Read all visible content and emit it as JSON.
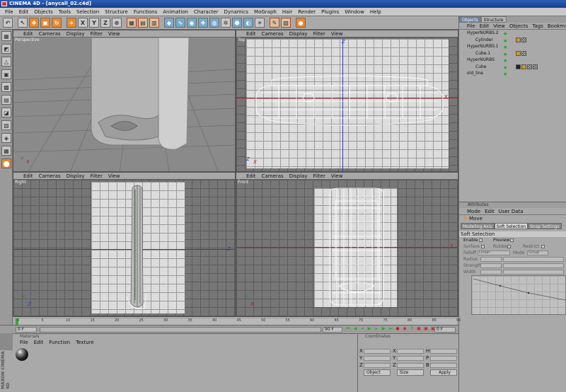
{
  "window": {
    "title": "CINEMA 4D - [anycall_02.c4d]"
  },
  "menubar": [
    "File",
    "Edit",
    "Objects",
    "Tools",
    "Selection",
    "Structure",
    "Functions",
    "Animation",
    "Character",
    "Dynamics",
    "MoGraph",
    "Hair",
    "Render",
    "Plugins",
    "Window",
    "Help"
  ],
  "toolbar": {
    "axis_x": "X",
    "axis_y": "Y",
    "axis_z": "Z"
  },
  "viewport_menu": [
    "Edit",
    "Cameras",
    "Display",
    "Filter",
    "View"
  ],
  "viewports": {
    "perspective": "Perspective",
    "top": "Top",
    "right": "Right",
    "front": "Front"
  },
  "axes": {
    "x": "X",
    "y": "Y",
    "z": "Z"
  },
  "objects_panel": {
    "tabs": [
      "Objects",
      "Structure"
    ],
    "menu": [
      "File",
      "Edit",
      "View",
      "Objects",
      "Tags",
      "Bookmarks"
    ],
    "items": [
      {
        "name": "HyperNURBS.2",
        "indent": 0
      },
      {
        "name": "Cylinder",
        "indent": 1
      },
      {
        "name": "HyperNURBS.1",
        "indent": 0
      },
      {
        "name": "Cube.1",
        "indent": 1
      },
      {
        "name": "HyperNURBS",
        "indent": 0
      },
      {
        "name": "Cube",
        "indent": 1
      },
      {
        "name": "old_line",
        "indent": 0
      }
    ]
  },
  "attributes": {
    "header": "Attributes",
    "menu": [
      "Mode",
      "Edit",
      "User Data"
    ],
    "tool": "Move",
    "tabs": [
      "Modeling Axis",
      "Soft Selection",
      "Snap Settings"
    ],
    "section": "Soft Selection",
    "enable": "Enable",
    "preview": "Preview",
    "surface": "Surface",
    "rubber": "Rubber",
    "restrict": "Restrict",
    "falloff_label": "Falloff",
    "falloff_value": "Linear",
    "mode_label": "Mode",
    "mode_value": "Group",
    "radius_label": "Radius",
    "strength_label": "Strength",
    "width_label": "Width"
  },
  "timeline": {
    "ticks": [
      "0",
      "5",
      "10",
      "15",
      "20",
      "25",
      "30",
      "35",
      "40",
      "45",
      "50",
      "55",
      "60",
      "65",
      "70",
      "75",
      "80",
      "85",
      "90"
    ],
    "current_frame": "0 F",
    "start": "0 F",
    "end": "90 F",
    "right_field": "0 F"
  },
  "materials": {
    "header": "Materials",
    "menu": [
      "File",
      "Edit",
      "Function",
      "Texture"
    ]
  },
  "coordinates": {
    "header": "Coordinates",
    "labels": [
      "X",
      "Y",
      "Z",
      "X",
      "Y",
      "Z",
      "H",
      "P",
      "B"
    ],
    "mode": "Object",
    "size": "Size",
    "apply": "Apply"
  },
  "branding": "MAXON CINEMA 4D"
}
